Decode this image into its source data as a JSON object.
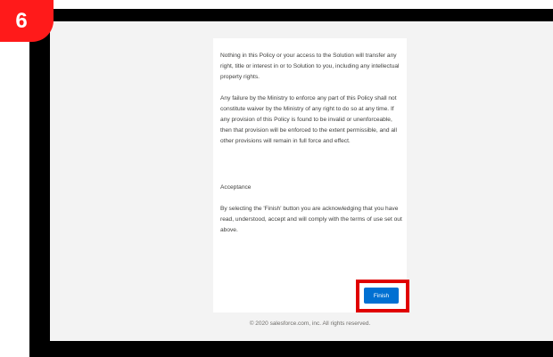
{
  "step_badge": {
    "label": "6",
    "color": "#ff1a1a"
  },
  "policy": {
    "paragraphs": [
      "Nothing in this Policy or your access to the Solution will transfer any right, title or interest in or to Solution to you, including any intellectual property rights.",
      "Any failure by the Ministry to enforce any part of this Policy shall not constitute waiver by the Ministry of any right to do so at any time. If any provision of this Policy is found to be invalid or unenforceable, then that provision will be enforced to the extent permissible, and all other provisions will remain in full force and effect."
    ],
    "acceptance_heading": "Acceptance",
    "acceptance_text": "By selecting the 'Finish' button you are acknowledging that you have read, understood, accept and will comply with the terms of use set out above."
  },
  "finish_button": {
    "label": "Finish",
    "color": "#0070d2",
    "highlight_color": "#e00000"
  },
  "footer": {
    "text": "© 2020 salesforce.com, inc. All rights reserved."
  }
}
